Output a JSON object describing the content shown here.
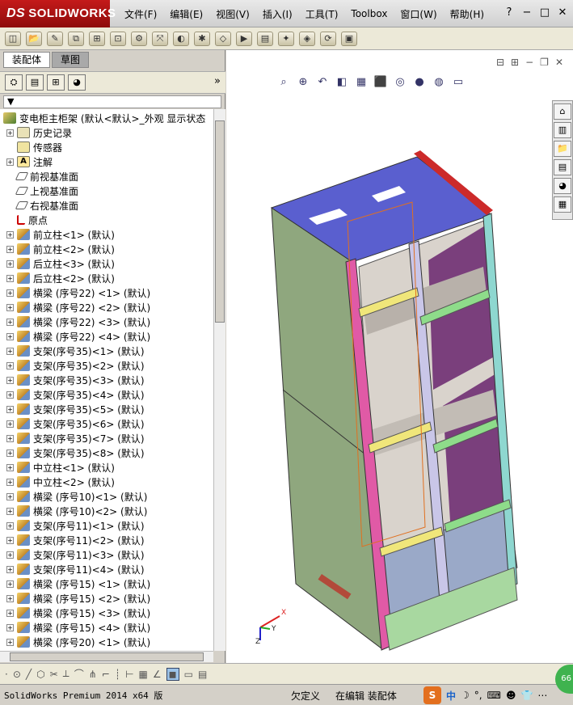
{
  "app": {
    "logo_ds": "DS",
    "logo_text": "SOLIDWORKS"
  },
  "menu": [
    "文件(F)",
    "编辑(E)",
    "视图(V)",
    "插入(I)",
    "工具(T)",
    "Toolbox",
    "窗口(W)",
    "帮助(H)"
  ],
  "window_controls": {
    "help": "?",
    "minimize": "−",
    "restore": "□",
    "close": "✕"
  },
  "left_panel": {
    "tabs": [
      "装配体",
      "草图"
    ],
    "filter": "▼",
    "expand": "»",
    "tree": [
      {
        "label": "变电柜主柜架   (默认<默认>_外观 显示状态",
        "icon": "assembly",
        "level": 0
      },
      {
        "label": "历史记录",
        "icon": "history",
        "level": 1,
        "expand": "+"
      },
      {
        "label": "传感器",
        "icon": "sensor",
        "level": 1
      },
      {
        "label": "注解",
        "icon": "annotation",
        "level": 1,
        "expand": "+"
      },
      {
        "label": "前视基准面",
        "icon": "plane",
        "level": 1
      },
      {
        "label": "上视基准面",
        "icon": "plane",
        "level": 1
      },
      {
        "label": "右视基准面",
        "icon": "plane",
        "level": 1
      },
      {
        "label": "原点",
        "icon": "origin",
        "level": 1
      },
      {
        "label": "前立柱<1> (默认)",
        "icon": "part",
        "level": 1,
        "expand": "+"
      },
      {
        "label": "前立柱<2> (默认)",
        "icon": "part",
        "level": 1,
        "expand": "+"
      },
      {
        "label": "后立柱<3> (默认)",
        "icon": "part",
        "level": 1,
        "expand": "+"
      },
      {
        "label": "后立柱<2> (默认)",
        "icon": "part",
        "level": 1,
        "expand": "+"
      },
      {
        "label": "横梁 (序号22) <1> (默认)",
        "icon": "part",
        "level": 1,
        "expand": "+"
      },
      {
        "label": "横梁 (序号22) <2> (默认)",
        "icon": "part",
        "level": 1,
        "expand": "+"
      },
      {
        "label": "横梁 (序号22) <3> (默认)",
        "icon": "part",
        "level": 1,
        "expand": "+"
      },
      {
        "label": "横梁 (序号22) <4> (默认)",
        "icon": "part",
        "level": 1,
        "expand": "+"
      },
      {
        "label": "支架(序号35)<1> (默认)",
        "icon": "part",
        "level": 1,
        "expand": "+"
      },
      {
        "label": "支架(序号35)<2> (默认)",
        "icon": "part",
        "level": 1,
        "expand": "+"
      },
      {
        "label": "支架(序号35)<3> (默认)",
        "icon": "part",
        "level": 1,
        "expand": "+"
      },
      {
        "label": "支架(序号35)<4> (默认)",
        "icon": "part",
        "level": 1,
        "expand": "+"
      },
      {
        "label": "支架(序号35)<5> (默认)",
        "icon": "part",
        "level": 1,
        "expand": "+"
      },
      {
        "label": "支架(序号35)<6> (默认)",
        "icon": "part",
        "level": 1,
        "expand": "+"
      },
      {
        "label": "支架(序号35)<7> (默认)",
        "icon": "part",
        "level": 1,
        "expand": "+"
      },
      {
        "label": "支架(序号35)<8> (默认)",
        "icon": "part",
        "level": 1,
        "expand": "+"
      },
      {
        "label": "中立柱<1> (默认)",
        "icon": "part",
        "level": 1,
        "expand": "+"
      },
      {
        "label": "中立柱<2> (默认)",
        "icon": "part",
        "level": 1,
        "expand": "+"
      },
      {
        "label": "横梁 (序号10)<1> (默认)",
        "icon": "part",
        "level": 1,
        "expand": "+"
      },
      {
        "label": "横梁 (序号10)<2> (默认)",
        "icon": "part",
        "level": 1,
        "expand": "+"
      },
      {
        "label": "支架(序号11)<1> (默认)",
        "icon": "part",
        "level": 1,
        "expand": "+"
      },
      {
        "label": "支架(序号11)<2> (默认)",
        "icon": "part",
        "level": 1,
        "expand": "+"
      },
      {
        "label": "支架(序号11)<3> (默认)",
        "icon": "part",
        "level": 1,
        "expand": "+"
      },
      {
        "label": "支架(序号11)<4> (默认)",
        "icon": "part",
        "level": 1,
        "expand": "+"
      },
      {
        "label": "横梁 (序号15) <1> (默认)",
        "icon": "part",
        "level": 1,
        "expand": "+"
      },
      {
        "label": "横梁 (序号15) <2> (默认)",
        "icon": "part",
        "level": 1,
        "expand": "+"
      },
      {
        "label": "横梁 (序号15) <3> (默认)",
        "icon": "part",
        "level": 1,
        "expand": "+"
      },
      {
        "label": "横梁 (序号15) <4> (默认)",
        "icon": "part",
        "level": 1,
        "expand": "+"
      },
      {
        "label": "横梁 (序号20) <1> (默认)",
        "icon": "part",
        "level": 1,
        "expand": "+"
      }
    ]
  },
  "triad": {
    "x": "X",
    "y": "Y",
    "z": "Z"
  },
  "status": {
    "product": "SolidWorks Premium 2014 x64 版",
    "underdefined": "欠定义",
    "editing": "在编辑 装配体"
  },
  "ime": {
    "logo": "S",
    "lang": "中",
    "moon": "☽",
    "dot": "°,"
  },
  "badge": "66",
  "colors": {
    "brand": "#c41a1a",
    "cabinet_side": "#8fa77e",
    "cabinet_top": "#5a5fcf",
    "rail": "#e05aa6",
    "ime": "#e36f1e",
    "badge": "#3fb34f"
  }
}
